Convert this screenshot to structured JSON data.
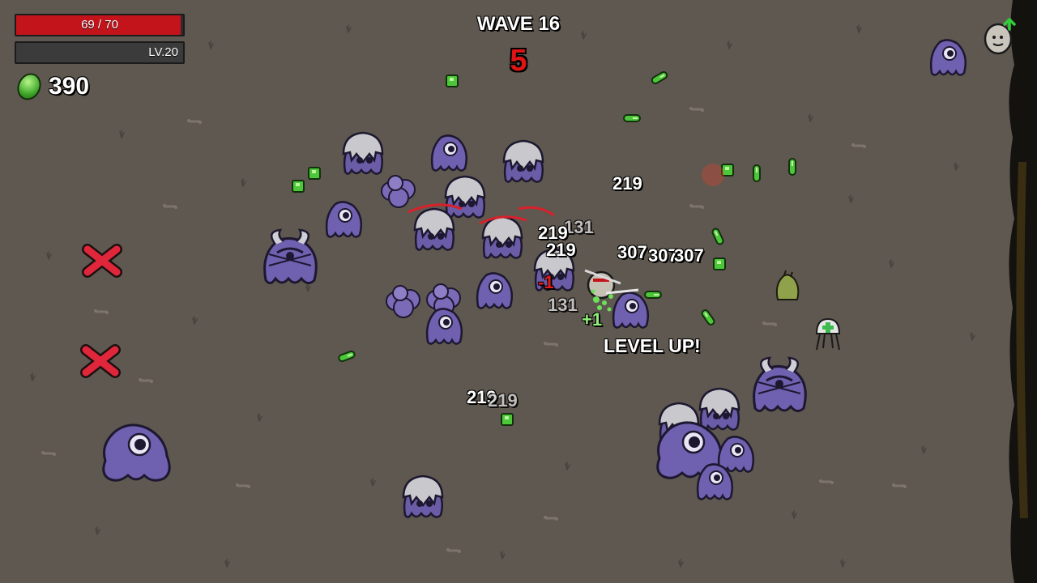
{
  "hud": {
    "hp_text": "69 / 70",
    "hp_fraction": 0.986,
    "level_text": "LV.20",
    "xp_fraction": 0.0,
    "materials_icon": "green-material-icon",
    "materials_count": "390"
  },
  "wave": {
    "title": "WAVE 16",
    "timer": "5"
  },
  "floating_text": {
    "levelup": "LEVEL UP!",
    "numbers": [
      {
        "text": "219",
        "style": "normal"
      },
      {
        "text": "131",
        "style": "faded"
      },
      {
        "text": "219",
        "style": "normal"
      },
      {
        "text": "219",
        "style": "normal"
      },
      {
        "text": "307",
        "style": "normal"
      },
      {
        "text": "307",
        "style": "normal"
      },
      {
        "text": "307",
        "style": "normal"
      },
      {
        "text": "-1",
        "style": "red"
      },
      {
        "text": "131",
        "style": "faded"
      },
      {
        "text": "+1",
        "style": "green"
      },
      {
        "text": "219",
        "style": "normal"
      },
      {
        "text": "219",
        "style": "faded"
      }
    ]
  },
  "colors": {
    "ground": "#5f5850",
    "enemy_purple": "#7a6ab8",
    "hp_red": "#c4141b",
    "material_green": "#4cc73a",
    "timer_red": "#e01414"
  },
  "icons": {
    "top_right": "egg-consumable-icon"
  }
}
